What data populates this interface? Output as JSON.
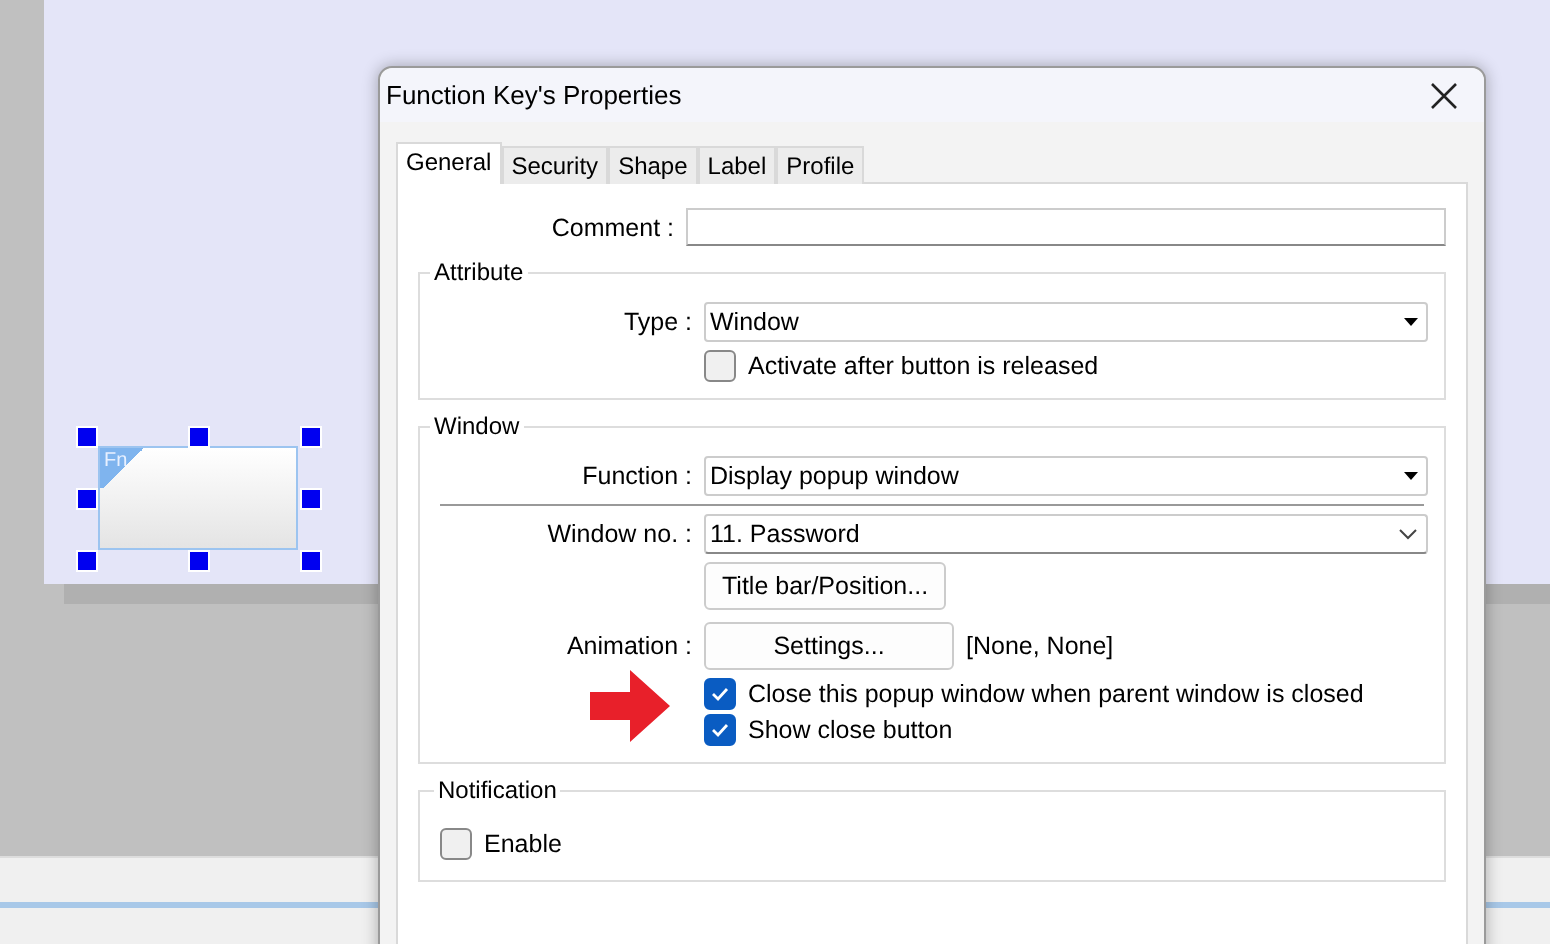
{
  "canvas": {
    "fn_key": {
      "label": "Fn",
      "selected": true
    }
  },
  "dialog": {
    "title": "Function Key's Properties",
    "tabs": [
      {
        "label": "General",
        "selected": true
      },
      {
        "label": "Security",
        "selected": false
      },
      {
        "label": "Shape",
        "selected": false
      },
      {
        "label": "Label",
        "selected": false
      },
      {
        "label": "Profile",
        "selected": false
      }
    ],
    "comment": {
      "label": "Comment :"
    },
    "attribute": {
      "title": "Attribute",
      "type": {
        "label": "Type :",
        "value": "Window"
      },
      "checkbox": {
        "label": "Activate after button is released",
        "checked": false
      }
    },
    "window": {
      "title": "Window",
      "function": {
        "label": "Function :",
        "value": "Display popup window"
      },
      "window_no": {
        "label": "Window no. :",
        "value": "11. Password"
      },
      "title_bar_button": "Title bar/Position...",
      "animation": {
        "label": "Animation :",
        "button": "Settings...",
        "value": "[None, None]"
      },
      "checkboxes": [
        {
          "label": "Close this popup window when parent window is closed",
          "checked": true,
          "highlighted": true
        },
        {
          "label": "Show close button",
          "checked": true,
          "highlighted": false
        }
      ]
    },
    "notification": {
      "title": "Notification",
      "checkbox": {
        "label": "Enable",
        "checked": false
      }
    }
  }
}
